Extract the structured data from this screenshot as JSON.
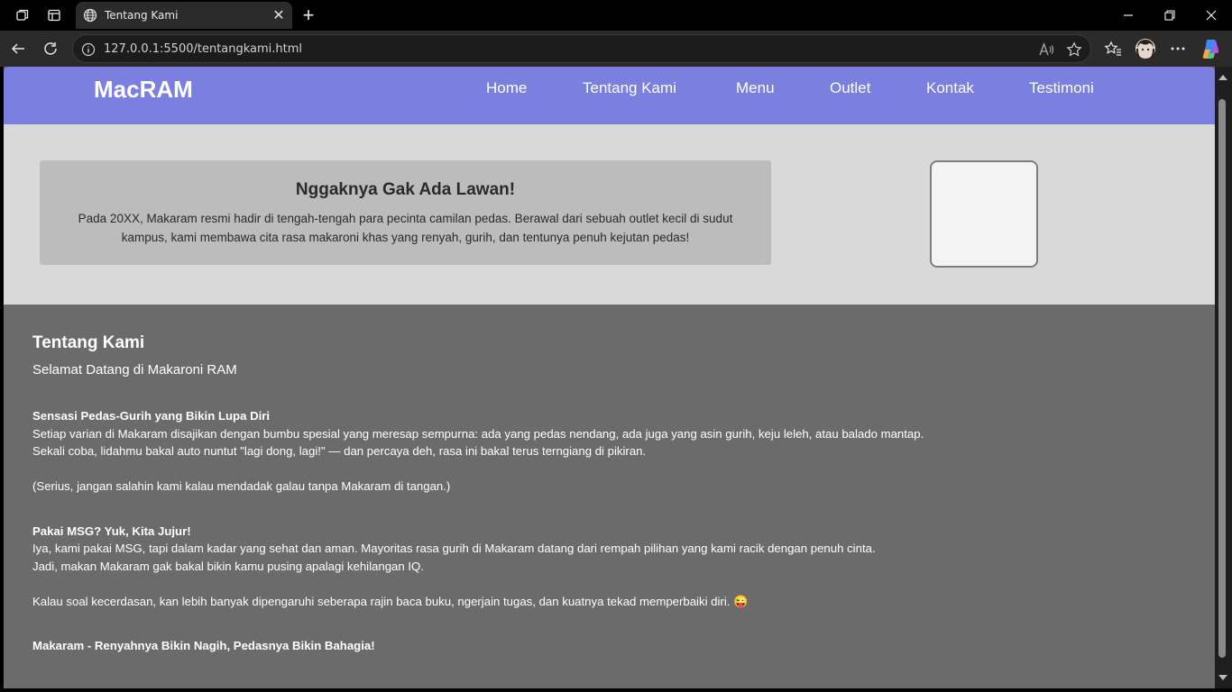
{
  "browser": {
    "tab_title": "Tentang Kami",
    "tab_close": "✕",
    "new_tab": "+",
    "url": "127.0.0.1:5500/tentangkami.html"
  },
  "nav": {
    "logo": "MacRAM",
    "items": [
      "Home",
      "Tentang Kami",
      "Menu",
      "Outlet",
      "Kontak",
      "Testimoni"
    ]
  },
  "hero": {
    "title": "Nggaknya Gak Ada Lawan!",
    "text": "Pada 20XX, Makaram resmi hadir di tengah-tengah para pecinta camilan pedas. Berawal dari sebuah outlet kecil di sudut kampus, kami membawa cita rasa makaroni khas yang renyah, gurih, dan tentunya penuh kejutan pedas!"
  },
  "about": {
    "title": "Tentang Kami",
    "subtitle": "Selamat Datang di Makaroni RAM",
    "s1_title": "Sensasi Pedas-Gurih yang Bikin Lupa Diri",
    "s1_line1": "Setiap varian di Makaram disajikan dengan bumbu spesial yang meresap sempurna: ada yang pedas nendang, ada juga yang asin gurih, keju leleh, atau balado mantap.",
    "s1_line2": "Sekali coba, lidahmu bakal auto nuntut \"lagi dong, lagi!\" — dan percaya deh, rasa ini bakal terus terngiang di pikiran.",
    "s1_note": "(Serius, jangan salahin kami kalau mendadak galau tanpa Makaram di tangan.)",
    "s2_title": "Pakai MSG? Yuk, Kita Jujur!",
    "s2_line1": "Iya, kami pakai MSG, tapi dalam kadar yang sehat dan aman. Mayoritas rasa gurih di Makaram datang dari rempah pilihan yang kami racik dengan penuh cinta.",
    "s2_line2": "Jadi, makan Makaram gak bakal bikin kamu pusing apalagi kehilangan IQ.",
    "s2_note": "Kalau soal kecerdasan, kan lebih banyak dipengaruhi seberapa rajin baca buku, ngerjain tugas, dan kuatnya tekad memperbaiki diri. 😜",
    "tagline": "Makaram - Renyahnya Bikin Nagih, Pedasnya Bikin Bahagia!"
  }
}
